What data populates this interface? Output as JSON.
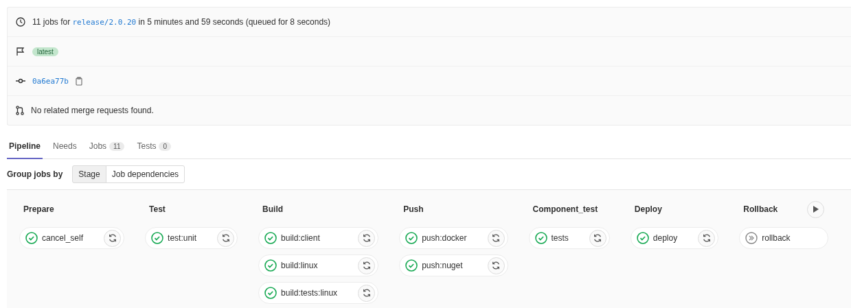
{
  "info": {
    "summary": {
      "prefix": "11 jobs for",
      "ref": "release/2.0.20",
      "suffix": "in 5 minutes and 59 seconds (queued for 8 seconds)"
    },
    "badges": [
      "latest"
    ],
    "commit": "0a6ea77b",
    "merge_requests": "No related merge requests found."
  },
  "tabs": [
    {
      "label": "Pipeline",
      "selected": true
    },
    {
      "label": "Needs",
      "selected": false
    },
    {
      "label": "Jobs",
      "count": "11",
      "selected": false
    },
    {
      "label": "Tests",
      "count": "0",
      "selected": false
    }
  ],
  "group_by": {
    "label": "Group jobs by",
    "options": [
      {
        "label": "Stage",
        "selected": true
      },
      {
        "label": "Job dependencies",
        "selected": false
      }
    ]
  },
  "stages": [
    {
      "name": "Prepare",
      "playable": false,
      "jobs": [
        {
          "name": "cancel_self",
          "kind": "success",
          "retryable": true
        }
      ]
    },
    {
      "name": "Test",
      "playable": false,
      "jobs": [
        {
          "name": "test:unit",
          "kind": "success",
          "retryable": true
        }
      ]
    },
    {
      "name": "Build",
      "playable": false,
      "jobs": [
        {
          "name": "build:client",
          "kind": "success",
          "retryable": true
        },
        {
          "name": "build:linux",
          "kind": "success",
          "retryable": true
        },
        {
          "name": "build:tests:linux",
          "kind": "success",
          "retryable": true
        }
      ]
    },
    {
      "name": "Push",
      "playable": false,
      "jobs": [
        {
          "name": "push:docker",
          "kind": "success",
          "retryable": true
        },
        {
          "name": "push:nuget",
          "kind": "success",
          "retryable": true
        }
      ]
    },
    {
      "name": "Component_test",
      "playable": false,
      "jobs": [
        {
          "name": "tests",
          "kind": "success",
          "retryable": true
        }
      ]
    },
    {
      "name": "Deploy",
      "playable": false,
      "jobs": [
        {
          "name": "deploy",
          "kind": "success",
          "retryable": true
        }
      ]
    },
    {
      "name": "Rollback",
      "playable": true,
      "jobs": [
        {
          "name": "rollback",
          "kind": "skipped",
          "retryable": false
        }
      ]
    }
  ]
}
